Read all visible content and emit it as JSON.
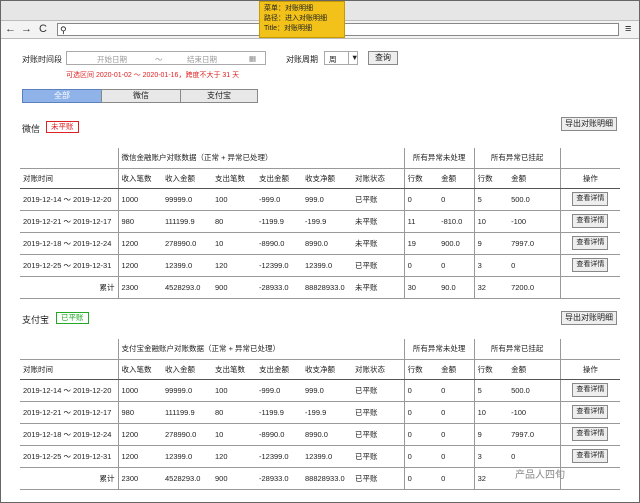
{
  "menu_note": {
    "line1": "菜单：对账明细",
    "line2": "路径：进入对账明细",
    "line3": "Title：对账明细"
  },
  "toolbar": {
    "back_icon": "←",
    "forward_icon": "→",
    "refresh_icon": "C",
    "search_icon": "⚲",
    "menu_icon": "≡"
  },
  "filter": {
    "period_label": "对账时间段",
    "start_placeholder": "开始日期",
    "tilde": "～",
    "end_placeholder": "结束日期",
    "cycle_label": "对账周期",
    "cycle_value": "周",
    "query_button": "查询",
    "hint": "可选区间 2020-01-02 ～ 2020-01-16，跨度不大于 31 天"
  },
  "tabs": [
    {
      "label": "全部"
    },
    {
      "label": "微信"
    },
    {
      "label": "支付宝"
    }
  ],
  "sections": [
    {
      "title": "微信",
      "status": "未平账",
      "export": "导出对账明细",
      "group_header": "微信金融账户对账数据（正常 + 异常已处理）",
      "abn_unhandled": "所有异常未处理",
      "abn_handled": "所有异常已挂起",
      "op_header": "操作",
      "cols": [
        "对账时间",
        "收入笔数",
        "收入金额",
        "支出笔数",
        "支出金额",
        "收支净额",
        "对账状态",
        "行数",
        "金额",
        "行数",
        "金额"
      ],
      "rows": [
        [
          "2019-12-14 ～ 2019-12-20",
          "1000",
          "99999.0",
          "100",
          "-999.0",
          "999.0",
          "已平账",
          "0",
          "0",
          "5",
          "500.0"
        ],
        [
          "2019-12-21 ～ 2019-12-17",
          "980",
          "111199.9",
          "80",
          "-1199.9",
          "-199.9",
          "未平账",
          "11",
          "-810.0",
          "10",
          "-100"
        ],
        [
          "2019-12-18 ～ 2019-12-24",
          "1200",
          "278990.0",
          "10",
          "-8990.0",
          "8990.0",
          "未平账",
          "19",
          "900.0",
          "9",
          "7997.0"
        ],
        [
          "2019-12-25 ～ 2019-12-31",
          "1200",
          "12399.0",
          "120",
          "-12399.0",
          "12399.0",
          "已平账",
          "0",
          "0",
          "3",
          "0"
        ]
      ],
      "total": [
        "累计",
        "2300",
        "4528293.0",
        "900",
        "-28933.0",
        "88828933.0",
        "未平账",
        "30",
        "90.0",
        "32",
        "7200.0"
      ],
      "detail_button": "查看详情"
    },
    {
      "title": "支付宝",
      "status": "已平账",
      "export": "导出对账明细",
      "group_header": "支付宝金融账户对账数据（正常 + 异常已处理）",
      "abn_unhandled": "所有异常未处理",
      "abn_handled": "所有异常已挂起",
      "op_header": "操作",
      "cols": [
        "对账时间",
        "收入笔数",
        "收入金额",
        "支出笔数",
        "支出金额",
        "收支净额",
        "对账状态",
        "行数",
        "金额",
        "行数",
        "金额"
      ],
      "rows": [
        [
          "2019-12-14 ～ 2019-12-20",
          "1000",
          "99999.0",
          "100",
          "-999.0",
          "999.0",
          "已平账",
          "0",
          "0",
          "5",
          "500.0"
        ],
        [
          "2019-12-21 ～ 2019-12-17",
          "980",
          "111199.9",
          "80",
          "-1199.9",
          "-199.9",
          "已平账",
          "0",
          "0",
          "10",
          "-100"
        ],
        [
          "2019-12-18 ～ 2019-12-24",
          "1200",
          "278990.0",
          "10",
          "-8990.0",
          "8990.0",
          "已平账",
          "0",
          "0",
          "9",
          "7997.0"
        ],
        [
          "2019-12-25 ～ 2019-12-31",
          "1200",
          "12399.0",
          "120",
          "-12399.0",
          "12399.0",
          "已平账",
          "0",
          "0",
          "3",
          "0"
        ]
      ],
      "total": [
        "累计",
        "2300",
        "4528293.0",
        "900",
        "-28933.0",
        "88828933.0",
        "已平账",
        "0",
        "0",
        "32",
        ""
      ],
      "detail_button": "查看详情"
    }
  ],
  "watermark": "产品人四旬"
}
